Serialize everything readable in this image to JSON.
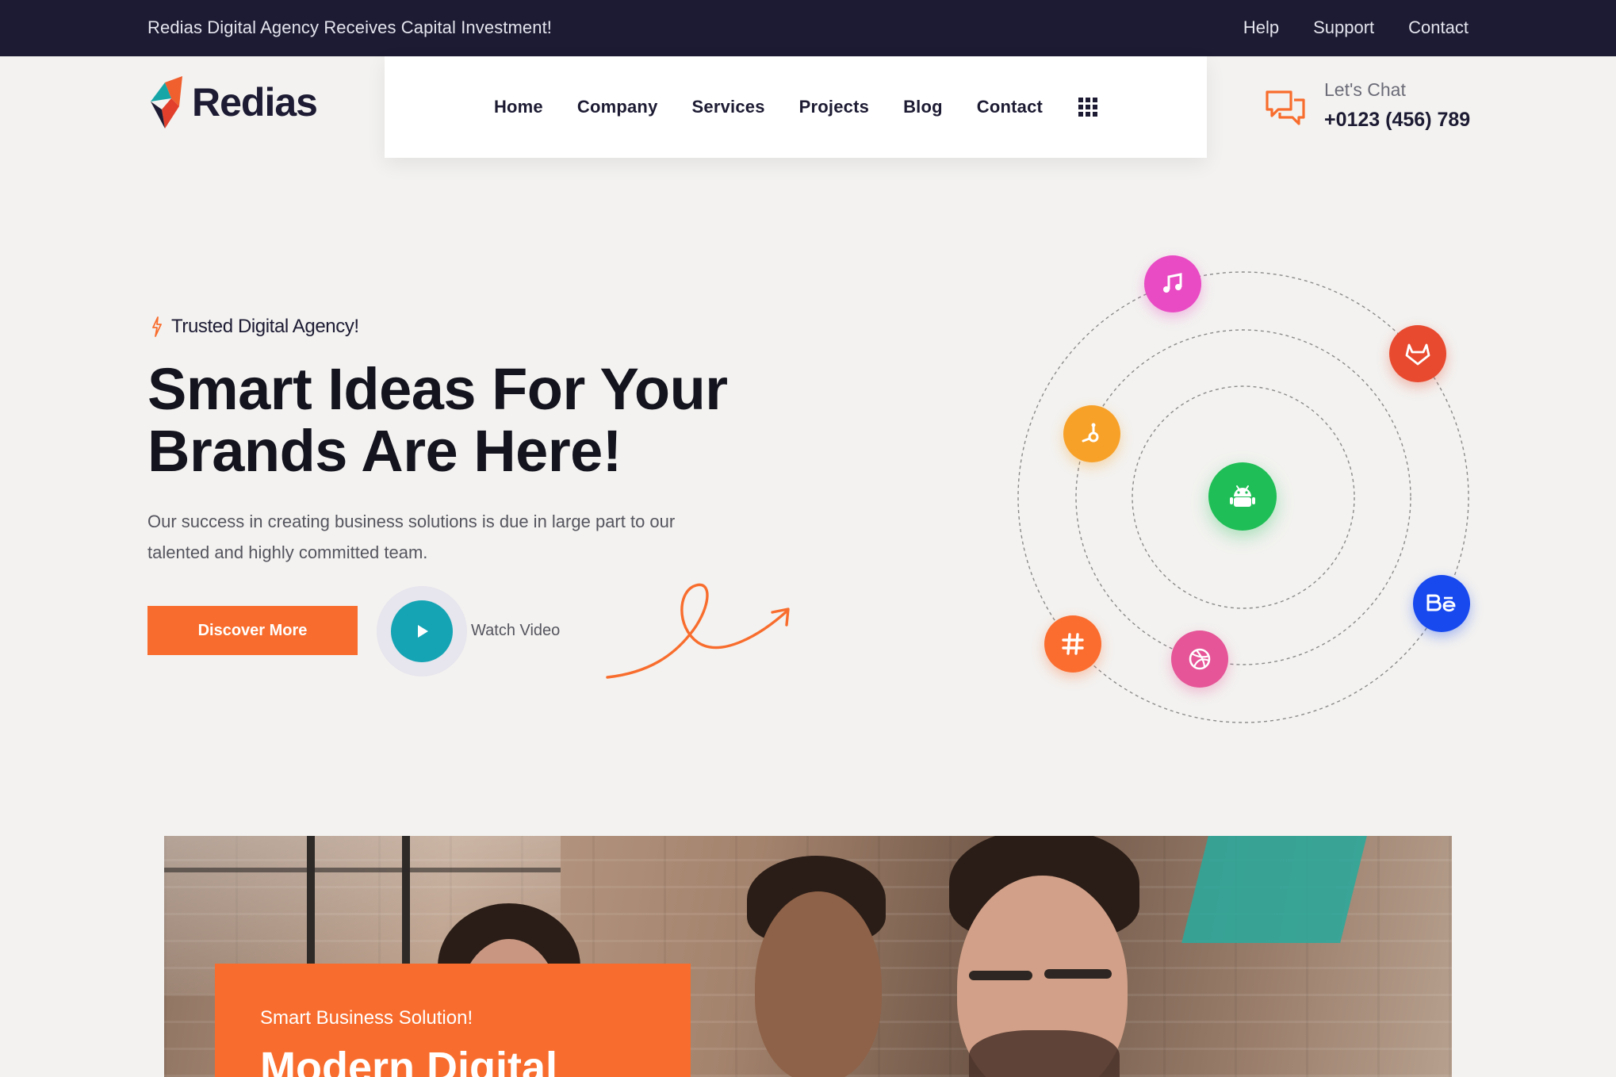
{
  "topbar": {
    "notice": "Redias Digital Agency Receives Capital Investment!",
    "links": [
      "Help",
      "Support",
      "Contact"
    ]
  },
  "header": {
    "brand": "Redias",
    "nav": [
      "Home",
      "Company",
      "Services",
      "Projects",
      "Blog",
      "Contact"
    ],
    "chat_label": "Let's Chat",
    "chat_phone": "+0123 (456) 789"
  },
  "hero": {
    "tagline": "Trusted Digital Agency!",
    "headline_line1": "Smart Ideas For Your",
    "headline_line2": "Brands Are Here!",
    "subtext": "Our success in creating business solutions is due in large part to our talented and highly committed team.",
    "cta_label": "Discover More",
    "video_label": "Watch Video"
  },
  "orbit_icons": [
    {
      "name": "music-note-icon",
      "color": "#e94bc4"
    },
    {
      "name": "gitlab-icon",
      "color": "#e84a2f"
    },
    {
      "name": "hubspot-icon",
      "color": "#f7a129"
    },
    {
      "name": "android-icon",
      "color": "#1fbe56"
    },
    {
      "name": "behance-icon",
      "color": "#1849ef"
    },
    {
      "name": "hashtag-icon",
      "color": "#fb6d2f"
    },
    {
      "name": "dribbble-icon",
      "color": "#e55597"
    }
  ],
  "feature_card": {
    "kicker": "Smart Business Solution!",
    "title": "Modern Digital"
  },
  "colors": {
    "accent": "#f86d2d",
    "dark": "#1c1b33",
    "play": "#14a4b4"
  }
}
